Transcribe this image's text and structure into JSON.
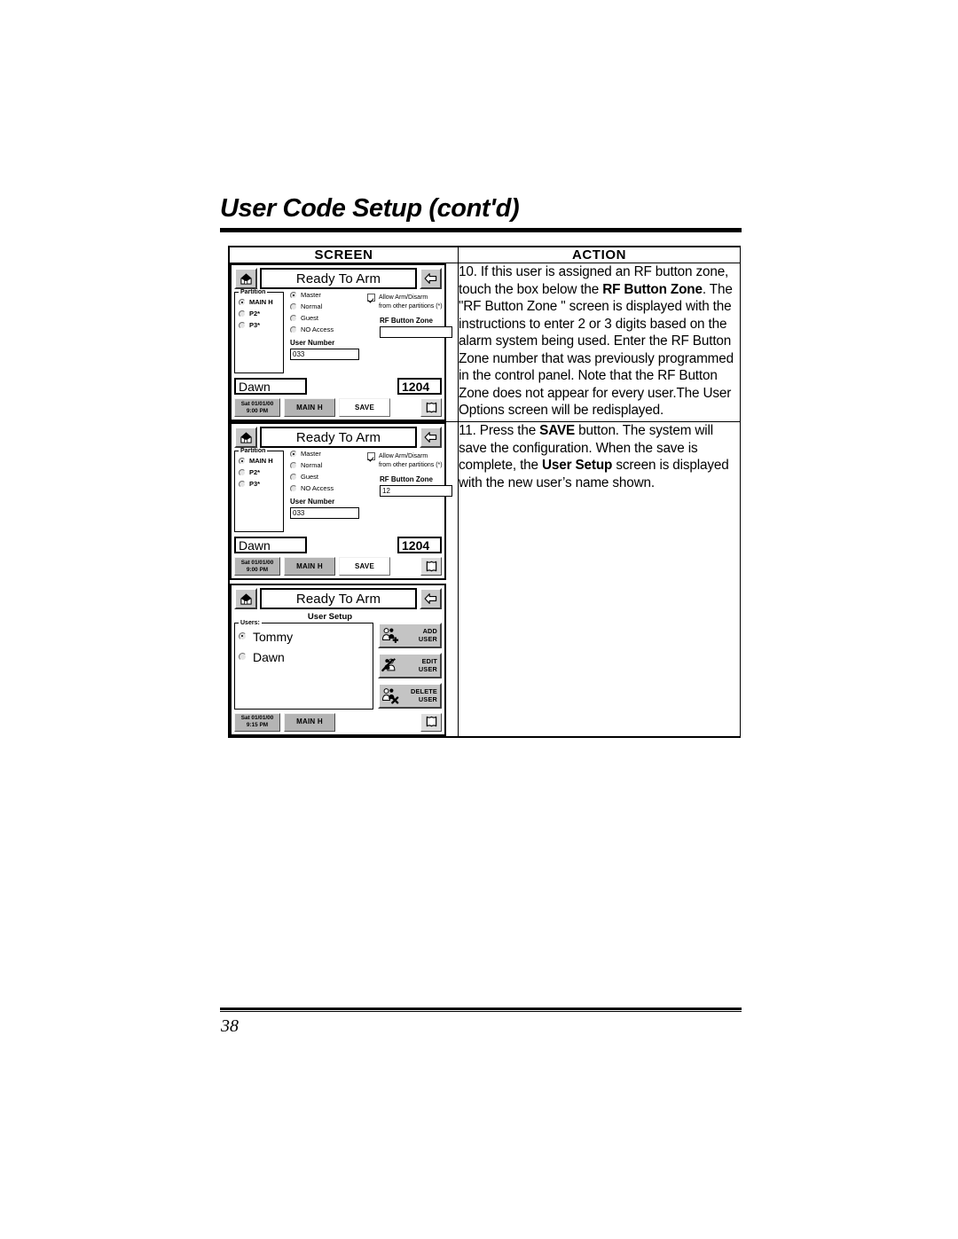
{
  "document": {
    "title": "User Code Setup (cont'd)",
    "page_number": "38"
  },
  "table": {
    "headers": {
      "screen": "SCREEN",
      "action": "ACTION"
    },
    "rows": [
      {
        "action": "10.  If this user is assigned an RF button zone, touch the box below the RF Button Zone.  The \"RF Button Zone \" screen is displayed with the instructions to enter 2 or 3 digits based on the alarm system being used. Enter the RF Button Zone number that was previously programmed in the control panel. Note that the RF Button Zone does not appear for every user.The User Options screen will be redisplayed.",
        "action_segments": [
          {
            "text": "10.  If this user is assigned an RF button zone, touch the box below the ",
            "bold": false
          },
          {
            "text": "RF Button Zone",
            "bold": true
          },
          {
            "text": ".  The \"RF Button Zone \" screen is displayed with the instructions to enter 2 or 3 digits based on the alarm system being used. Enter the RF Button Zone number that was previously programmed in the control panel. Note that the RF Button Zone does not appear for every user.The User Options screen will be redisplayed.",
            "bold": false
          }
        ]
      },
      {
        "action": "11.  Press the SAVE button.  The system will save the configuration.  When the save is complete, the User Setup screen is displayed with the new user's name shown.",
        "action_segments": [
          {
            "text": "11.  Press the ",
            "bold": false
          },
          {
            "text": "SAVE",
            "bold": true
          },
          {
            "text": " button.  The system will save the configuration.  When the save is complete, the ",
            "bold": false
          },
          {
            "text": "User Setup",
            "bold": true
          },
          {
            "text": " screen is displayed with the new user’s name shown.",
            "bold": false
          }
        ]
      }
    ]
  },
  "screens": {
    "user_options_1": {
      "status_text": "Ready To Arm",
      "home_icon": "home-icon",
      "back_icon": "back-arrow-icon",
      "partition": {
        "legend": "Partition",
        "options": [
          {
            "label": "MAIN H",
            "selected": true
          },
          {
            "label": "P2*",
            "selected": false
          },
          {
            "label": "P3*",
            "selected": false
          }
        ]
      },
      "authority": [
        {
          "label": "Master",
          "selected": true
        },
        {
          "label": "Normal",
          "selected": false
        },
        {
          "label": "Guest",
          "selected": false
        },
        {
          "label": "NO Access",
          "selected": false
        }
      ],
      "checkbox": {
        "checked": true,
        "line1": "Allow Arm/Disarm",
        "line2": "from other partitions (*)"
      },
      "user_number": {
        "label": "User Number",
        "value": "033"
      },
      "rf_button_zone": {
        "label": "RF Button Zone",
        "value": ""
      },
      "user_name": "Dawn",
      "user_code": "1204",
      "bottom": {
        "date": "Sat 01/01/00",
        "time": "9:00 PM",
        "main_button": "MAIN H",
        "save_button": "SAVE",
        "panic_icon": "panic-shield-icon"
      }
    },
    "user_options_2": {
      "status_text": "Ready To Arm",
      "home_icon": "home-icon",
      "back_icon": "back-arrow-icon",
      "partition": {
        "legend": "Partition",
        "options": [
          {
            "label": "MAIN H",
            "selected": true
          },
          {
            "label": "P2*",
            "selected": false
          },
          {
            "label": "P3*",
            "selected": false
          }
        ]
      },
      "authority": [
        {
          "label": "Master",
          "selected": true
        },
        {
          "label": "Normal",
          "selected": false
        },
        {
          "label": "Guest",
          "selected": false
        },
        {
          "label": "NO Access",
          "selected": false
        }
      ],
      "checkbox": {
        "checked": true,
        "line1": "Allow Arm/Disarm",
        "line2": "from other partitions (*)"
      },
      "user_number": {
        "label": "User Number",
        "value": "033"
      },
      "rf_button_zone": {
        "label": "RF Button Zone",
        "value": "12"
      },
      "user_name": "Dawn",
      "user_code": "1204",
      "bottom": {
        "date": "Sat 01/01/00",
        "time": "9:00 PM",
        "main_button": "MAIN H",
        "save_button": "SAVE",
        "panic_icon": "panic-shield-icon"
      }
    },
    "user_setup": {
      "status_text": "Ready To Arm",
      "home_icon": "home-icon",
      "back_icon": "back-arrow-icon",
      "title": "User Setup",
      "users_legend": "Users:",
      "users": [
        {
          "name": "Tommy",
          "selected": true
        },
        {
          "name": "Dawn",
          "selected": false
        }
      ],
      "buttons": [
        {
          "line1": "ADD",
          "line2": "USER",
          "icon": "add-user-icon"
        },
        {
          "line1": "EDIT",
          "line2": "USER",
          "icon": "edit-user-icon"
        },
        {
          "line1": "DELETE",
          "line2": "USER",
          "icon": "delete-user-icon"
        }
      ],
      "bottom": {
        "date": "Sat 01/01/00",
        "time": "9:15 PM",
        "main_button": "MAIN H",
        "panic_icon": "panic-shield-icon"
      }
    }
  }
}
